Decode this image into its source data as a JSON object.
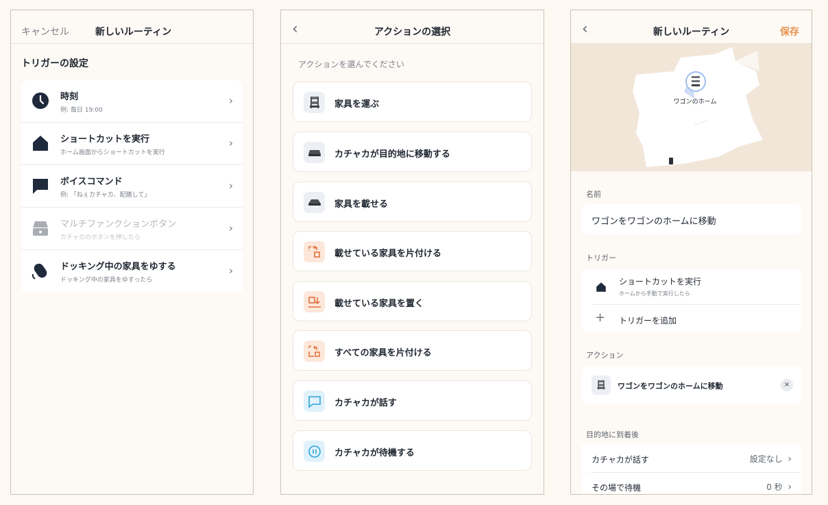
{
  "panel1": {
    "cancel": "キャンセル",
    "title": "新しいルーティン",
    "section": "トリガーの設定",
    "triggers": [
      {
        "title": "時刻",
        "sub": "例: 毎日 19:00",
        "icon": "clock-icon"
      },
      {
        "title": "ショートカットを実行",
        "sub": "ホーム画面からショートカットを実行",
        "icon": "home-icon"
      },
      {
        "title": "ボイスコマンド",
        "sub": "例: 「ねぇカチャカ、配膳して」",
        "icon": "speech-bubble-icon"
      },
      {
        "title": "マルチファンクションボタン",
        "sub": "カチャカのボタンを押したら",
        "icon": "multifunction-button-icon",
        "disabled": true
      },
      {
        "title": "ドッキング中の家具をゆする",
        "sub": "ドッキング中の家具をゆすったら",
        "icon": "shake-furniture-icon"
      }
    ],
    "chevron": "›"
  },
  "panel2": {
    "back": "‹",
    "title": "アクションの選択",
    "prompt": "アクションを選んでください",
    "actions": [
      {
        "label": "家具を運ぶ",
        "icon": "wagon-icon"
      },
      {
        "label": "カチャカが目的地に移動する",
        "icon": "robot-move-icon"
      },
      {
        "label": "家具を載せる",
        "icon": "robot-load-icon"
      },
      {
        "label": "載せている家具を片付ける",
        "icon": "return-furniture-icon"
      },
      {
        "label": "載せている家具を置く",
        "icon": "place-furniture-icon"
      },
      {
        "label": "すべての家具を片付ける",
        "icon": "return-all-icon"
      },
      {
        "label": "カチャカが話す",
        "icon": "speak-icon"
      },
      {
        "label": "カチャカが待機する",
        "icon": "pause-icon"
      }
    ]
  },
  "panel3": {
    "back": "‹",
    "title": "新しいルーティン",
    "save": "保存",
    "map_pin_label": "ワゴンのホーム",
    "name_label": "名前",
    "name_value": "ワゴンをワゴンのホームに移動",
    "trigger_label": "トリガー",
    "trigger_title": "ショートカットを実行",
    "trigger_sub": "ホームから手動で実行したら",
    "add_trigger": "トリガーを追加",
    "plus": "+",
    "action_label": "アクション",
    "action_value": "ワゴンをワゴンのホームに移動",
    "remove": "×",
    "after_label": "目的地に到着後",
    "after_rows": [
      {
        "key": "カチャカが話す",
        "value": "設定なし"
      },
      {
        "key": "その場で待機",
        "value": "0 秒"
      }
    ],
    "chevron": "›"
  },
  "colors": {
    "accent": "#e8924f",
    "navy": "#1f2a3c",
    "orange_tint": "#fde7da",
    "blue_tint": "#dff1fb",
    "gray_tint": "#eceff3"
  }
}
